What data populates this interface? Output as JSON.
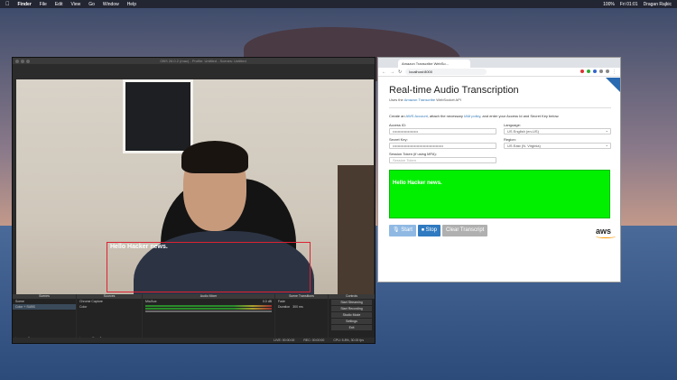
{
  "menubar": {
    "app": "Finder",
    "items": [
      "File",
      "Edit",
      "View",
      "Go",
      "Window",
      "Help"
    ],
    "clock": "Fri 01:01",
    "user": "Dragan Rajkic",
    "battery": "100%"
  },
  "obs": {
    "title": "OBS 26.0.2 (mac) - Profile: Untitled - Scenes: Untitled",
    "overlay_text": "Hello Hacker news.",
    "docks": {
      "scenes": {
        "header": "Scenes",
        "items": [
          "Scene",
          "Color + SUBS"
        ]
      },
      "sources": {
        "header": "Sources",
        "items": [
          "Chrome Capture",
          "Color"
        ]
      },
      "mixer": {
        "header": "Audio Mixer",
        "channel": "Mic/Aux",
        "level": "0.0 dB"
      },
      "transitions": {
        "header": "Scene Transitions",
        "type": "Fade",
        "duration_label": "Duration",
        "duration": "300 ms"
      },
      "controls": {
        "header": "Controls",
        "buttons": [
          "Start Streaming",
          "Start Recording",
          "Studio Mode",
          "Settings",
          "Exit"
        ]
      }
    },
    "status": {
      "live": "LIVE: 00:00:00",
      "rec": "REC: 00:00:00",
      "cpu": "CPU: 5.8%, 30.00 fps"
    }
  },
  "browser": {
    "tab_title": "Amazon Transcribe WebSo...",
    "url": "localhost:8000",
    "page": {
      "title": "Real-time Audio Transcription",
      "subtitle_prefix": "Uses the",
      "subtitle_link": "Amazon Transcribe",
      "subtitle_suffix": "WebSocket API",
      "intro_prefix": "Create an",
      "intro_link1": "AWS Account",
      "intro_mid": ", attach the necessary",
      "intro_link2": "IAM policy",
      "intro_suffix": ", and enter your Access Id and Secret Key below.",
      "access_id_label": "Access ID:",
      "access_id_value": "••••••••••••••••••••",
      "language_label": "Language:",
      "language_value": "US English (en-US)",
      "secret_key_label": "Secret Key:",
      "secret_key_value": "••••••••••••••••••••••••••••••••••••••••",
      "region_label": "Region:",
      "region_value": "US East (N. Virginia)",
      "session_label": "Session Token (if using MFA):",
      "session_placeholder": "Session Token",
      "transcript": "Hello Hacker news.",
      "start_label": "Start",
      "stop_label": "Stop",
      "clear_label": "Clear Transcript",
      "logo_text": "aws"
    }
  }
}
